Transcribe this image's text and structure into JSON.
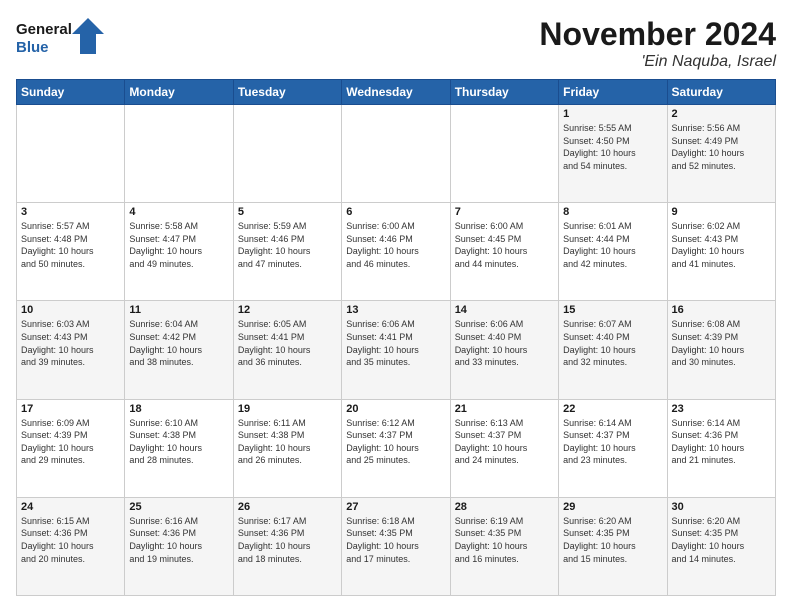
{
  "logo": {
    "line1": "General",
    "line2": "Blue"
  },
  "header": {
    "month_title": "November 2024",
    "location": "'Ein Naquba, Israel"
  },
  "weekdays": [
    "Sunday",
    "Monday",
    "Tuesday",
    "Wednesday",
    "Thursday",
    "Friday",
    "Saturday"
  ],
  "weeks": [
    [
      {
        "day": "",
        "info": ""
      },
      {
        "day": "",
        "info": ""
      },
      {
        "day": "",
        "info": ""
      },
      {
        "day": "",
        "info": ""
      },
      {
        "day": "",
        "info": ""
      },
      {
        "day": "1",
        "info": "Sunrise: 5:55 AM\nSunset: 4:50 PM\nDaylight: 10 hours\nand 54 minutes."
      },
      {
        "day": "2",
        "info": "Sunrise: 5:56 AM\nSunset: 4:49 PM\nDaylight: 10 hours\nand 52 minutes."
      }
    ],
    [
      {
        "day": "3",
        "info": "Sunrise: 5:57 AM\nSunset: 4:48 PM\nDaylight: 10 hours\nand 50 minutes."
      },
      {
        "day": "4",
        "info": "Sunrise: 5:58 AM\nSunset: 4:47 PM\nDaylight: 10 hours\nand 49 minutes."
      },
      {
        "day": "5",
        "info": "Sunrise: 5:59 AM\nSunset: 4:46 PM\nDaylight: 10 hours\nand 47 minutes."
      },
      {
        "day": "6",
        "info": "Sunrise: 6:00 AM\nSunset: 4:46 PM\nDaylight: 10 hours\nand 46 minutes."
      },
      {
        "day": "7",
        "info": "Sunrise: 6:00 AM\nSunset: 4:45 PM\nDaylight: 10 hours\nand 44 minutes."
      },
      {
        "day": "8",
        "info": "Sunrise: 6:01 AM\nSunset: 4:44 PM\nDaylight: 10 hours\nand 42 minutes."
      },
      {
        "day": "9",
        "info": "Sunrise: 6:02 AM\nSunset: 4:43 PM\nDaylight: 10 hours\nand 41 minutes."
      }
    ],
    [
      {
        "day": "10",
        "info": "Sunrise: 6:03 AM\nSunset: 4:43 PM\nDaylight: 10 hours\nand 39 minutes."
      },
      {
        "day": "11",
        "info": "Sunrise: 6:04 AM\nSunset: 4:42 PM\nDaylight: 10 hours\nand 38 minutes."
      },
      {
        "day": "12",
        "info": "Sunrise: 6:05 AM\nSunset: 4:41 PM\nDaylight: 10 hours\nand 36 minutes."
      },
      {
        "day": "13",
        "info": "Sunrise: 6:06 AM\nSunset: 4:41 PM\nDaylight: 10 hours\nand 35 minutes."
      },
      {
        "day": "14",
        "info": "Sunrise: 6:06 AM\nSunset: 4:40 PM\nDaylight: 10 hours\nand 33 minutes."
      },
      {
        "day": "15",
        "info": "Sunrise: 6:07 AM\nSunset: 4:40 PM\nDaylight: 10 hours\nand 32 minutes."
      },
      {
        "day": "16",
        "info": "Sunrise: 6:08 AM\nSunset: 4:39 PM\nDaylight: 10 hours\nand 30 minutes."
      }
    ],
    [
      {
        "day": "17",
        "info": "Sunrise: 6:09 AM\nSunset: 4:39 PM\nDaylight: 10 hours\nand 29 minutes."
      },
      {
        "day": "18",
        "info": "Sunrise: 6:10 AM\nSunset: 4:38 PM\nDaylight: 10 hours\nand 28 minutes."
      },
      {
        "day": "19",
        "info": "Sunrise: 6:11 AM\nSunset: 4:38 PM\nDaylight: 10 hours\nand 26 minutes."
      },
      {
        "day": "20",
        "info": "Sunrise: 6:12 AM\nSunset: 4:37 PM\nDaylight: 10 hours\nand 25 minutes."
      },
      {
        "day": "21",
        "info": "Sunrise: 6:13 AM\nSunset: 4:37 PM\nDaylight: 10 hours\nand 24 minutes."
      },
      {
        "day": "22",
        "info": "Sunrise: 6:14 AM\nSunset: 4:37 PM\nDaylight: 10 hours\nand 23 minutes."
      },
      {
        "day": "23",
        "info": "Sunrise: 6:14 AM\nSunset: 4:36 PM\nDaylight: 10 hours\nand 21 minutes."
      }
    ],
    [
      {
        "day": "24",
        "info": "Sunrise: 6:15 AM\nSunset: 4:36 PM\nDaylight: 10 hours\nand 20 minutes."
      },
      {
        "day": "25",
        "info": "Sunrise: 6:16 AM\nSunset: 4:36 PM\nDaylight: 10 hours\nand 19 minutes."
      },
      {
        "day": "26",
        "info": "Sunrise: 6:17 AM\nSunset: 4:36 PM\nDaylight: 10 hours\nand 18 minutes."
      },
      {
        "day": "27",
        "info": "Sunrise: 6:18 AM\nSunset: 4:35 PM\nDaylight: 10 hours\nand 17 minutes."
      },
      {
        "day": "28",
        "info": "Sunrise: 6:19 AM\nSunset: 4:35 PM\nDaylight: 10 hours\nand 16 minutes."
      },
      {
        "day": "29",
        "info": "Sunrise: 6:20 AM\nSunset: 4:35 PM\nDaylight: 10 hours\nand 15 minutes."
      },
      {
        "day": "30",
        "info": "Sunrise: 6:20 AM\nSunset: 4:35 PM\nDaylight: 10 hours\nand 14 minutes."
      }
    ]
  ]
}
